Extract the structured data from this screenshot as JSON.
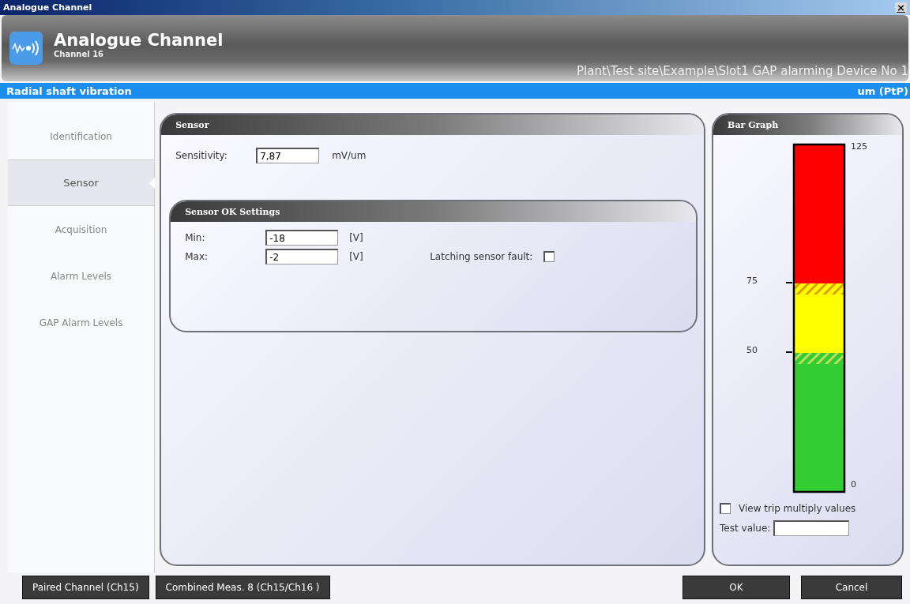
{
  "window": {
    "title": "Analogue Channel",
    "close": "×"
  },
  "header": {
    "title": "Analogue Channel",
    "subtitle": "Channel 16",
    "path": "Plant\\Test site\\Example\\Slot1 GAP alarming Device No 1"
  },
  "info_bar": {
    "measurement": "Radial shaft vibration",
    "unit": "um (PtP)"
  },
  "sidebar": {
    "items": [
      {
        "label": "Identification",
        "selected": false
      },
      {
        "label": "Sensor",
        "selected": true
      },
      {
        "label": "Acquisition",
        "selected": false
      },
      {
        "label": "Alarm Levels",
        "selected": false
      },
      {
        "label": "GAP Alarm Levels",
        "selected": false
      }
    ]
  },
  "sensor_panel": {
    "title": "Sensor",
    "sensitivity": {
      "label": "Sensitivity:",
      "value": "7,87",
      "unit": "mV/um"
    },
    "ok_settings": {
      "title": "Sensor OK Settings",
      "min": {
        "label": "Min:",
        "value": "-18",
        "unit": "[V]"
      },
      "max": {
        "label": "Max:",
        "value": "-2",
        "unit": "[V]"
      },
      "latching": {
        "label": "Latching sensor fault:",
        "checked": false
      }
    }
  },
  "bar_graph": {
    "title": "Bar Graph",
    "ticks": [
      "125",
      "75",
      "50",
      "0"
    ],
    "zones": [
      {
        "color": "#ff0000"
      },
      {
        "color": "#ffff00"
      },
      {
        "color": "#33cc33"
      }
    ],
    "view_trip": {
      "label": "View trip multiply values",
      "checked": false
    },
    "test_value": {
      "label": "Test value:"
    }
  },
  "footer": {
    "left_buttons": [
      "Paired Channel (Ch15)",
      "Combined Meas. 8 (Ch15/Ch16 )"
    ],
    "right_buttons": [
      "OK",
      "Cancel"
    ]
  }
}
